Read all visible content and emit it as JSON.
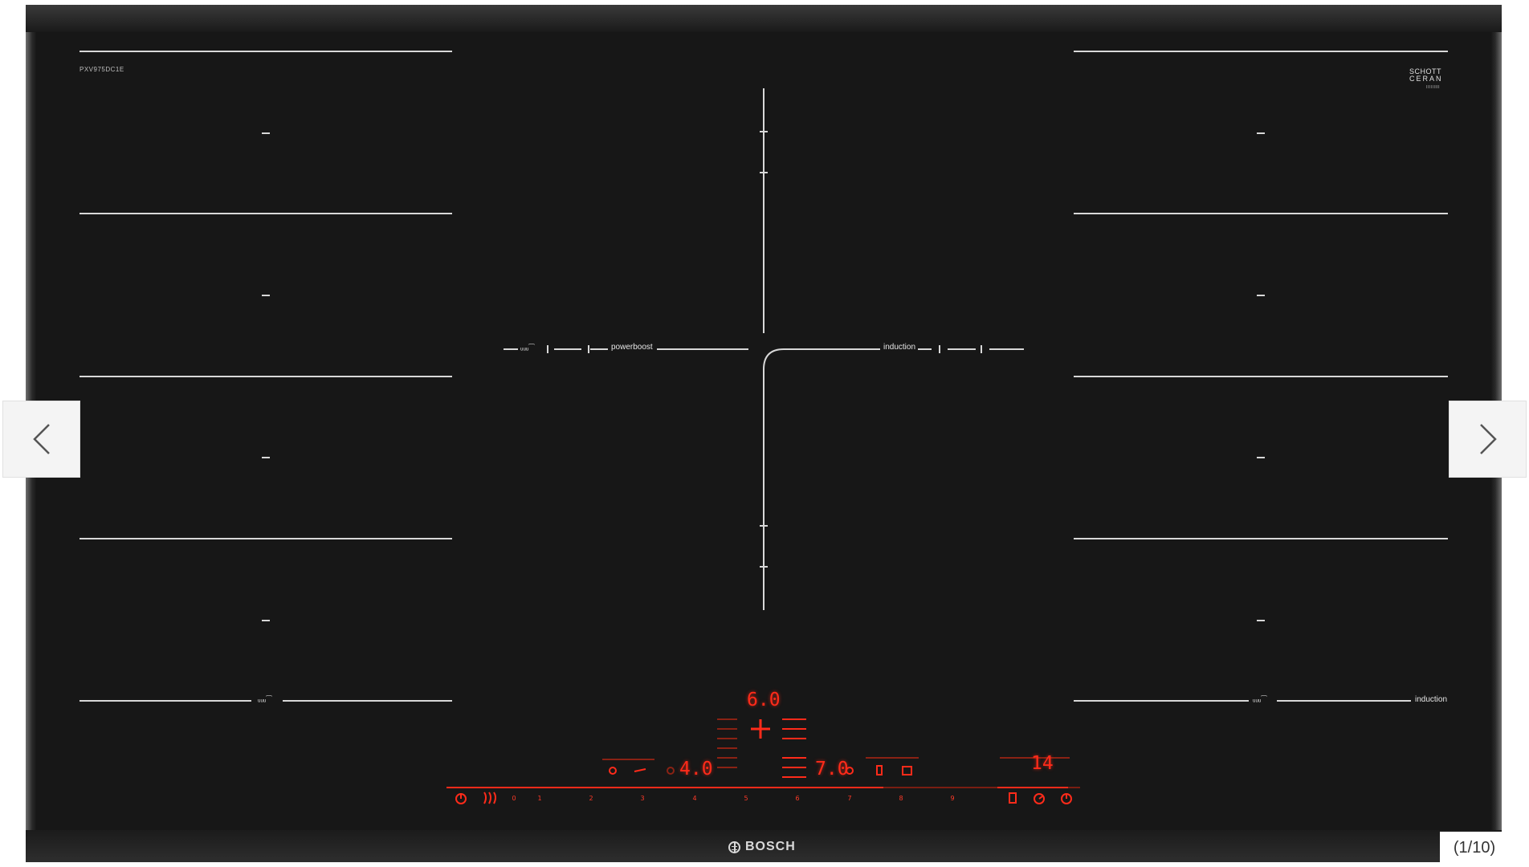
{
  "hob": {
    "brand": "BOSCH",
    "model_code": "PXV975DC1E",
    "glass_maker": [
      "SCHOTT",
      "CERAN"
    ],
    "glass_maker_sub": "IIIIIIIII",
    "zone_labels": {
      "powerboost": "powerboost",
      "induction_middle": "induction",
      "induction_right": "induction"
    },
    "flex_symbol": "ᵤᵤᵤ⁀"
  },
  "controls": {
    "top_display": "6.0",
    "left_display": "4.0",
    "center_display": "7.0",
    "right_display": "14",
    "slider_scale": [
      "0",
      "1",
      "2",
      "3",
      "4",
      "5",
      "6",
      "7",
      "8",
      "9"
    ],
    "icons": [
      "power-icon",
      "child-lock-icon",
      "plus-minus-icon",
      "timer-icon",
      "clock-icon"
    ]
  },
  "accent_color": "#ff2b1a",
  "gallery": {
    "counter": "(1/10)",
    "prev_icon": "chevron-left-icon",
    "next_icon": "chevron-right-icon"
  }
}
